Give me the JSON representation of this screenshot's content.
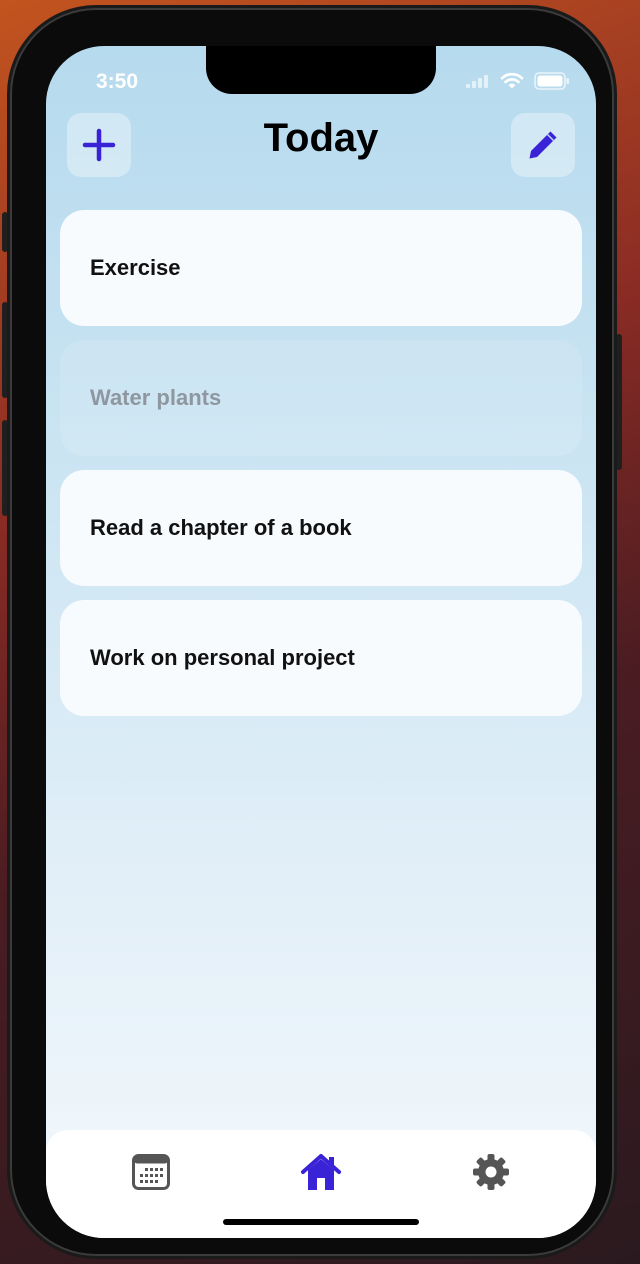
{
  "status_bar": {
    "time": "3:50"
  },
  "header": {
    "title": "Today",
    "add_icon": "plus-icon",
    "edit_icon": "pencil-icon"
  },
  "tasks": [
    {
      "label": "Exercise",
      "completed": false
    },
    {
      "label": "Water plants",
      "completed": true
    },
    {
      "label": "Read a chapter of a book",
      "completed": false
    },
    {
      "label": "Work on personal project",
      "completed": false
    }
  ],
  "tab_bar": {
    "items": [
      {
        "icon": "calendar-icon",
        "selected": false
      },
      {
        "icon": "house-icon",
        "selected": true
      },
      {
        "icon": "gear-icon",
        "selected": false
      }
    ]
  },
  "colors": {
    "accent": "#3a22d6",
    "inactive_icon": "#555555",
    "completed_text": "#8e979f"
  }
}
